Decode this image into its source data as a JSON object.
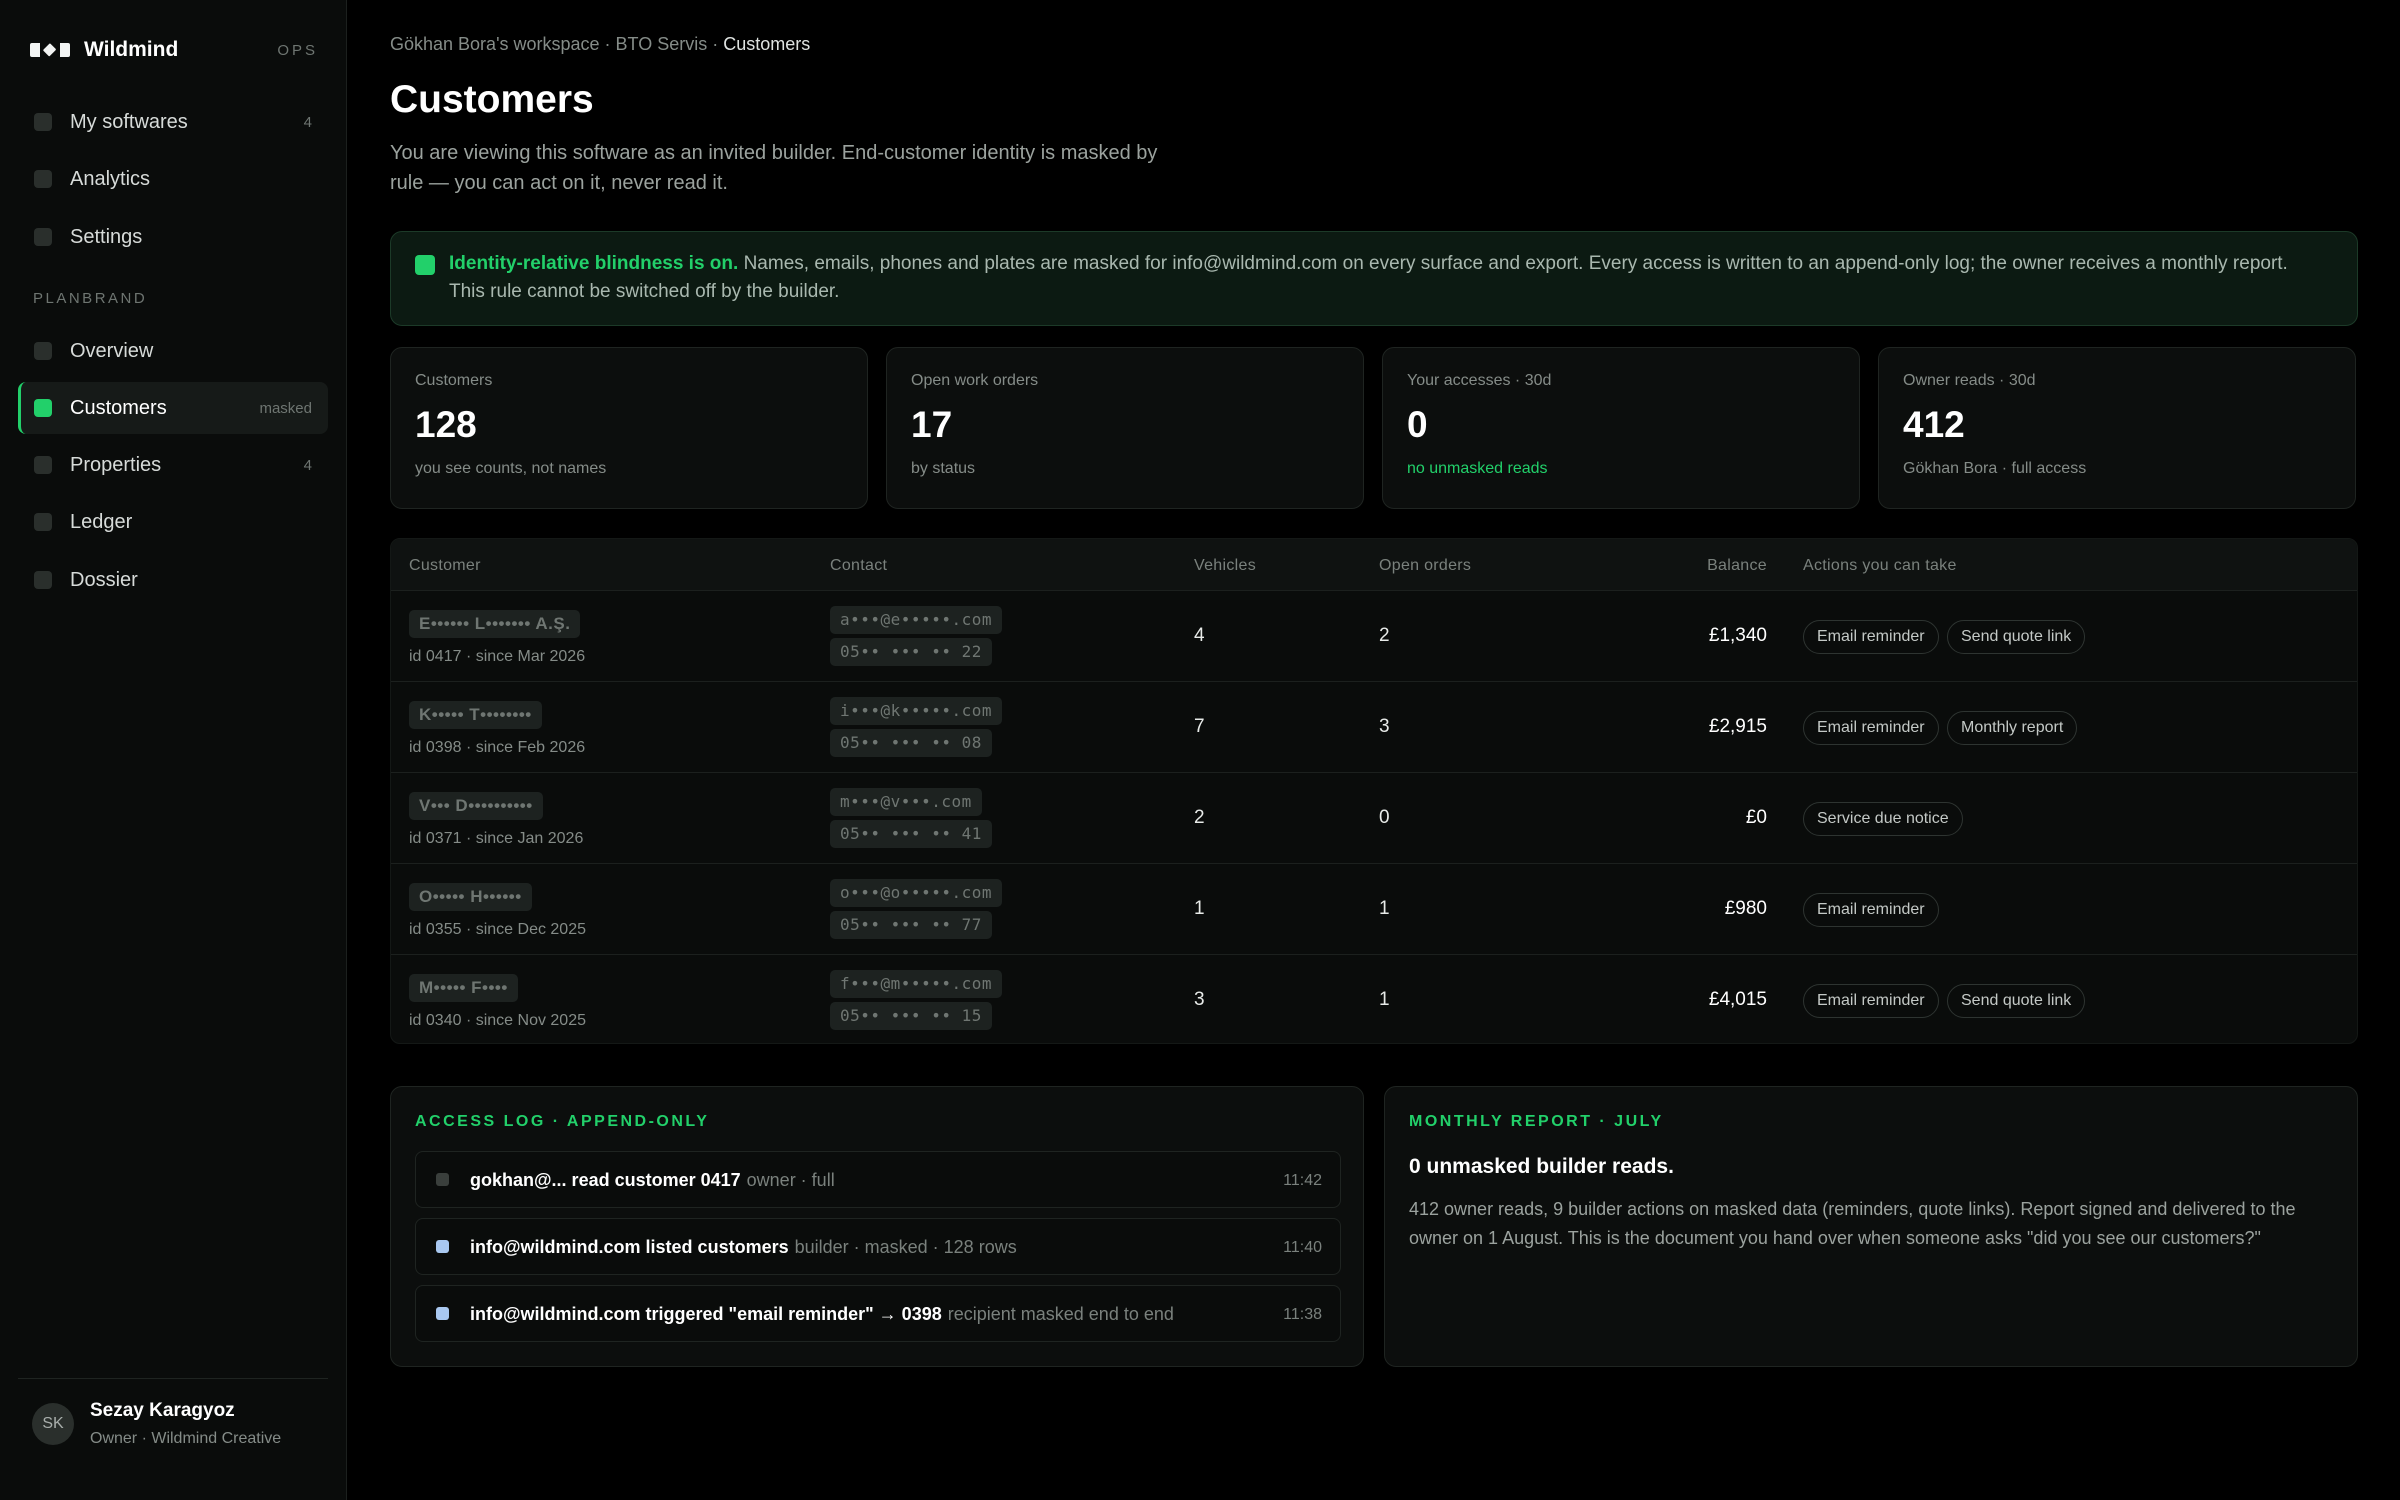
{
  "brand": {
    "name": "Wildmind",
    "tag": "OPS"
  },
  "sidebar": {
    "top_items": [
      {
        "label": "My softwares",
        "count": "4"
      },
      {
        "label": "Analytics",
        "count": ""
      },
      {
        "label": "Settings",
        "count": ""
      }
    ],
    "section_label": "PLANBRAND",
    "items": [
      {
        "label": "Overview",
        "count": ""
      },
      {
        "label": "Customers",
        "count": "masked"
      },
      {
        "label": "Properties",
        "count": "4"
      },
      {
        "label": "Ledger",
        "count": ""
      },
      {
        "label": "Dossier",
        "count": ""
      }
    ]
  },
  "user": {
    "initials": "SK",
    "name": "Sezay Karagyoz",
    "role": "Owner · Wildmind Creative"
  },
  "breadcrumb": {
    "path": "Gökhan Bora's workspace · BTO Servis · ",
    "current": "Customers"
  },
  "page": {
    "title": "Customers",
    "subtitle": "You are viewing this software as an invited builder. End-customer identity is masked by rule — you can act on it, never read it."
  },
  "banner": {
    "highlight": "Identity-relative blindness is on.",
    "text": " Names, emails, phones and plates are masked for info@wildmind.com on every surface and export. Every access is written to an append-only log; the owner receives a monthly report. This rule cannot be switched off by the builder."
  },
  "stats": [
    {
      "label": "Customers",
      "value": "128",
      "note": "you see counts, not names"
    },
    {
      "label": "Open work orders",
      "value": "17",
      "note": "by status"
    },
    {
      "label": "Your accesses · 30d",
      "value": "0",
      "note": "no unmasked reads"
    },
    {
      "label": "Owner reads · 30d",
      "value": "412",
      "note": "Gökhan Bora · full access"
    }
  ],
  "table": {
    "headers": [
      "Customer",
      "Contact",
      "Vehicles",
      "Open orders",
      "Balance",
      "Actions you can take"
    ],
    "rows": [
      {
        "name": "E•••••• L••••••• A.Ş.",
        "meta": "id 0417 · since Mar 2026",
        "email": "a•••@e•••••.com",
        "phone": "05•• ••• •• 22",
        "vehicles": "4",
        "open_orders": "2",
        "balance": "£1,340",
        "actions": [
          "Email reminder",
          "Send quote link"
        ]
      },
      {
        "name": "K••••• T••••••••",
        "meta": "id 0398 · since Feb 2026",
        "email": "i•••@k•••••.com",
        "phone": "05•• ••• •• 08",
        "vehicles": "7",
        "open_orders": "3",
        "balance": "£2,915",
        "actions": [
          "Email reminder",
          "Monthly report"
        ]
      },
      {
        "name": "V••• D••••••••••",
        "meta": "id 0371 · since Jan 2026",
        "email": "m•••@v•••.com",
        "phone": "05•• ••• •• 41",
        "vehicles": "2",
        "open_orders": "0",
        "balance": "£0",
        "actions": [
          "Service due notice"
        ]
      },
      {
        "name": "O••••• H••••••",
        "meta": "id 0355 · since Dec 2025",
        "email": "o•••@o•••••.com",
        "phone": "05•• ••• •• 77",
        "vehicles": "1",
        "open_orders": "1",
        "balance": "£980",
        "actions": [
          "Email reminder"
        ]
      },
      {
        "name": "M••••• F••••",
        "meta": "id 0340 · since Nov 2025",
        "email": "f•••@m•••••.com",
        "phone": "05•• ••• •• 15",
        "vehicles": "3",
        "open_orders": "1",
        "balance": "£4,015",
        "actions": [
          "Email reminder",
          "Send quote link"
        ]
      }
    ]
  },
  "access_log": {
    "title": "ACCESS LOG · APPEND-ONLY",
    "entries": [
      {
        "main": "gokhan@... read customer 0417",
        "detail": "owner · full",
        "time": "11:42",
        "color": "#3a3f3c"
      },
      {
        "main": "info@wildmind.com listed customers",
        "detail": "builder · masked · 128 rows",
        "time": "11:40",
        "color": "#a9c8f0"
      },
      {
        "main": "info@wildmind.com triggered \"email reminder\" → 0398",
        "detail": "recipient masked end to end",
        "time": "11:38",
        "color": "#a9c8f0"
      }
    ]
  },
  "report": {
    "title": "MONTHLY REPORT · JULY",
    "headline": "0 unmasked builder reads.",
    "body": "412 owner reads, 9 builder actions on masked data (reminders, quote links). Report signed and delivered to the owner on 1 August. This is the document you hand over when someone asks \"did you see our customers?\""
  },
  "colors": {
    "accent": "#22d06a",
    "background": "#000000",
    "sidebar": "#0a0c0b"
  }
}
